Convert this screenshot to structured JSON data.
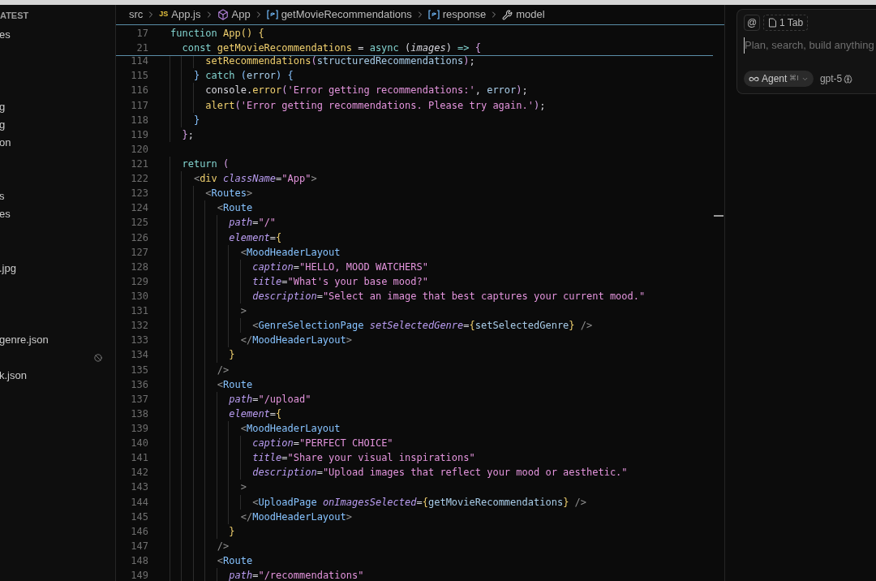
{
  "sidebar": {
    "header": "ATEST",
    "rows": [
      {
        "kind": "file",
        "label": "es"
      },
      {
        "kind": "blank"
      },
      {
        "kind": "blank"
      },
      {
        "kind": "blank"
      },
      {
        "kind": "file",
        "label": "g"
      },
      {
        "kind": "file",
        "label": "g"
      },
      {
        "kind": "file",
        "label": "on"
      },
      {
        "kind": "blank"
      },
      {
        "kind": "blank"
      },
      {
        "kind": "file",
        "label": "s"
      },
      {
        "kind": "file",
        "label": "es"
      },
      {
        "kind": "blank"
      },
      {
        "kind": "blank"
      },
      {
        "kind": "file",
        "label": ".jpg"
      },
      {
        "kind": "blank"
      },
      {
        "kind": "blank"
      },
      {
        "kind": "blank"
      },
      {
        "kind": "file",
        "label": "genre.json"
      },
      {
        "kind": "status"
      },
      {
        "kind": "file",
        "label": "k.json"
      }
    ]
  },
  "breadcrumb": [
    {
      "kind": "folder",
      "label": "src"
    },
    {
      "kind": "file",
      "badge": "JS",
      "label": "App.js"
    },
    {
      "kind": "component",
      "label": "App"
    },
    {
      "kind": "variable",
      "label": "getMovieRecommendations"
    },
    {
      "kind": "variable",
      "label": "response"
    },
    {
      "kind": "property",
      "label": "model"
    }
  ],
  "sticky_lines": [
    {
      "number": "17",
      "tokens": [
        {
          "kind": "keyword",
          "text": "function "
        },
        {
          "kind": "function",
          "text": "App"
        },
        {
          "kind": "brace",
          "text": "() {"
        }
      ]
    },
    {
      "number": "21",
      "tokens": [
        {
          "kind": "keyword",
          "text": "  const "
        },
        {
          "kind": "function",
          "text": "getMovieRecommendations"
        },
        {
          "kind": "plain",
          "text": " = "
        },
        {
          "kind": "keyword",
          "text": "async "
        },
        {
          "kind": "plain",
          "text": "("
        },
        {
          "kind": "param",
          "text": "images"
        },
        {
          "kind": "plain",
          "text": ") "
        },
        {
          "kind": "keyword",
          "text": "=> "
        },
        {
          "kind": "paren",
          "text": "{"
        }
      ]
    }
  ],
  "lines": [
    {
      "number": "114",
      "tokens": [
        {
          "kind": "function",
          "text": "      setRecommendations"
        },
        {
          "kind": "paren",
          "text": "("
        },
        {
          "kind": "variable",
          "text": "structuredRecommendations"
        },
        {
          "kind": "paren",
          "text": ")"
        },
        {
          "kind": "plain",
          "text": ";"
        }
      ]
    },
    {
      "number": "115",
      "tokens": [
        {
          "kind": "block",
          "text": "    } "
        },
        {
          "kind": "keyword",
          "text": "catch "
        },
        {
          "kind": "block",
          "text": "("
        },
        {
          "kind": "variable",
          "text": "error"
        },
        {
          "kind": "block",
          "text": ") {"
        }
      ]
    },
    {
      "number": "116",
      "tokens": [
        {
          "kind": "plain",
          "text": "      console."
        },
        {
          "kind": "function",
          "text": "error"
        },
        {
          "kind": "paren",
          "text": "("
        },
        {
          "kind": "string",
          "text": "'Error getting recommendations:'"
        },
        {
          "kind": "plain",
          "text": ", "
        },
        {
          "kind": "variable",
          "text": "error"
        },
        {
          "kind": "paren",
          "text": ")"
        },
        {
          "kind": "plain",
          "text": ";"
        }
      ]
    },
    {
      "number": "117",
      "tokens": [
        {
          "kind": "function",
          "text": "      alert"
        },
        {
          "kind": "paren",
          "text": "("
        },
        {
          "kind": "string",
          "text": "'Error getting recommendations. Please try again.'"
        },
        {
          "kind": "paren",
          "text": ")"
        },
        {
          "kind": "plain",
          "text": ";"
        }
      ]
    },
    {
      "number": "118",
      "tokens": [
        {
          "kind": "block",
          "text": "    }"
        }
      ]
    },
    {
      "number": "119",
      "tokens": [
        {
          "kind": "paren",
          "text": "  }"
        },
        {
          "kind": "plain",
          "text": ";"
        }
      ]
    },
    {
      "number": "120"
    },
    {
      "number": "121",
      "tokens": [
        {
          "kind": "keyword",
          "text": "  return "
        },
        {
          "kind": "paren",
          "text": "("
        }
      ]
    },
    {
      "number": "122",
      "tokens": [
        {
          "kind": "bracket",
          "text": "    <"
        },
        {
          "kind": "brace",
          "text": "div "
        },
        {
          "kind": "attr",
          "text": "className"
        },
        {
          "kind": "plain",
          "text": "="
        },
        {
          "kind": "string",
          "text": "\"App\""
        },
        {
          "kind": "bracket",
          "text": ">"
        }
      ]
    },
    {
      "number": "123",
      "tokens": [
        {
          "kind": "bracket",
          "text": "      <"
        },
        {
          "kind": "tag",
          "text": "Routes"
        },
        {
          "kind": "bracket",
          "text": ">"
        }
      ]
    },
    {
      "number": "124",
      "tokens": [
        {
          "kind": "bracket",
          "text": "        <"
        },
        {
          "kind": "tag",
          "text": "Route"
        }
      ]
    },
    {
      "number": "125",
      "tokens": [
        {
          "kind": "attr",
          "text": "          path"
        },
        {
          "kind": "plain",
          "text": "="
        },
        {
          "kind": "string",
          "text": "\"/\""
        }
      ]
    },
    {
      "number": "126",
      "tokens": [
        {
          "kind": "attr",
          "text": "          element"
        },
        {
          "kind": "plain",
          "text": "="
        },
        {
          "kind": "brace",
          "text": "{"
        }
      ]
    },
    {
      "number": "127",
      "tokens": [
        {
          "kind": "bracket",
          "text": "            <"
        },
        {
          "kind": "tag",
          "text": "MoodHeaderLayout"
        }
      ]
    },
    {
      "number": "128",
      "tokens": [
        {
          "kind": "attr",
          "text": "              caption"
        },
        {
          "kind": "plain",
          "text": "="
        },
        {
          "kind": "string",
          "text": "\"HELLO, MOOD WATCHERS\""
        }
      ]
    },
    {
      "number": "129",
      "tokens": [
        {
          "kind": "attr",
          "text": "              title"
        },
        {
          "kind": "plain",
          "text": "="
        },
        {
          "kind": "string",
          "text": "\"What's your base mood?\""
        }
      ]
    },
    {
      "number": "130",
      "tokens": [
        {
          "kind": "attr",
          "text": "              description"
        },
        {
          "kind": "plain",
          "text": "="
        },
        {
          "kind": "string",
          "text": "\"Select an image that best captures your current mood.\""
        }
      ]
    },
    {
      "number": "131",
      "tokens": [
        {
          "kind": "bracket",
          "text": "            >"
        }
      ]
    },
    {
      "number": "132",
      "tokens": [
        {
          "kind": "bracket",
          "text": "              <"
        },
        {
          "kind": "tag",
          "text": "GenreSelectionPage "
        },
        {
          "kind": "attr",
          "text": "setSelectedGenre"
        },
        {
          "kind": "plain",
          "text": "="
        },
        {
          "kind": "brace",
          "text": "{"
        },
        {
          "kind": "variable",
          "text": "setSelectedGenre"
        },
        {
          "kind": "brace",
          "text": "}"
        },
        {
          "kind": "bracket",
          "text": " />"
        }
      ]
    },
    {
      "number": "133",
      "tokens": [
        {
          "kind": "bracket",
          "text": "            </"
        },
        {
          "kind": "tag",
          "text": "MoodHeaderLayout"
        },
        {
          "kind": "bracket",
          "text": ">"
        }
      ]
    },
    {
      "number": "134",
      "tokens": [
        {
          "kind": "brace",
          "text": "          }"
        }
      ]
    },
    {
      "number": "135",
      "tokens": [
        {
          "kind": "bracket",
          "text": "        />"
        }
      ]
    },
    {
      "number": "136",
      "tokens": [
        {
          "kind": "bracket",
          "text": "        <"
        },
        {
          "kind": "tag",
          "text": "Route"
        }
      ]
    },
    {
      "number": "137",
      "tokens": [
        {
          "kind": "attr",
          "text": "          path"
        },
        {
          "kind": "plain",
          "text": "="
        },
        {
          "kind": "string",
          "text": "\"/upload\""
        }
      ]
    },
    {
      "number": "138",
      "tokens": [
        {
          "kind": "attr",
          "text": "          element"
        },
        {
          "kind": "plain",
          "text": "="
        },
        {
          "kind": "brace",
          "text": "{"
        }
      ]
    },
    {
      "number": "139",
      "tokens": [
        {
          "kind": "bracket",
          "text": "            <"
        },
        {
          "kind": "tag",
          "text": "MoodHeaderLayout"
        }
      ]
    },
    {
      "number": "140",
      "tokens": [
        {
          "kind": "attr",
          "text": "              caption"
        },
        {
          "kind": "plain",
          "text": "="
        },
        {
          "kind": "string",
          "text": "\"PERFECT CHOICE\""
        }
      ]
    },
    {
      "number": "141",
      "tokens": [
        {
          "kind": "attr",
          "text": "              title"
        },
        {
          "kind": "plain",
          "text": "="
        },
        {
          "kind": "string",
          "text": "\"Share your visual inspirations\""
        }
      ]
    },
    {
      "number": "142",
      "tokens": [
        {
          "kind": "attr",
          "text": "              description"
        },
        {
          "kind": "plain",
          "text": "="
        },
        {
          "kind": "string",
          "text": "\"Upload images that reflect your mood or aesthetic.\""
        }
      ]
    },
    {
      "number": "143",
      "tokens": [
        {
          "kind": "bracket",
          "text": "            >"
        }
      ]
    },
    {
      "number": "144",
      "tokens": [
        {
          "kind": "bracket",
          "text": "              <"
        },
        {
          "kind": "tag",
          "text": "UploadPage "
        },
        {
          "kind": "attr",
          "text": "onImagesSelected"
        },
        {
          "kind": "plain",
          "text": "="
        },
        {
          "kind": "brace",
          "text": "{"
        },
        {
          "kind": "variable",
          "text": "getMovieRecommendations"
        },
        {
          "kind": "brace",
          "text": "}"
        },
        {
          "kind": "bracket",
          "text": " />"
        }
      ]
    },
    {
      "number": "145",
      "tokens": [
        {
          "kind": "bracket",
          "text": "            </"
        },
        {
          "kind": "tag",
          "text": "MoodHeaderLayout"
        },
        {
          "kind": "bracket",
          "text": ">"
        }
      ]
    },
    {
      "number": "146",
      "tokens": [
        {
          "kind": "brace",
          "text": "          }"
        }
      ]
    },
    {
      "number": "147",
      "tokens": [
        {
          "kind": "bracket",
          "text": "        />"
        }
      ]
    },
    {
      "number": "148",
      "tokens": [
        {
          "kind": "bracket",
          "text": "        <"
        },
        {
          "kind": "tag",
          "text": "Route"
        }
      ]
    },
    {
      "number": "149",
      "tokens": [
        {
          "kind": "attr",
          "text": "          path"
        },
        {
          "kind": "plain",
          "text": "="
        },
        {
          "kind": "string",
          "text": "\"/recommendations\""
        }
      ]
    }
  ],
  "chat": {
    "mention": "@",
    "context_chip": "1 Tab",
    "placeholder": "Plan, search, build anything",
    "mode": {
      "label": "Agent",
      "shortcut": "⌘I"
    },
    "model": "gpt-5"
  }
}
